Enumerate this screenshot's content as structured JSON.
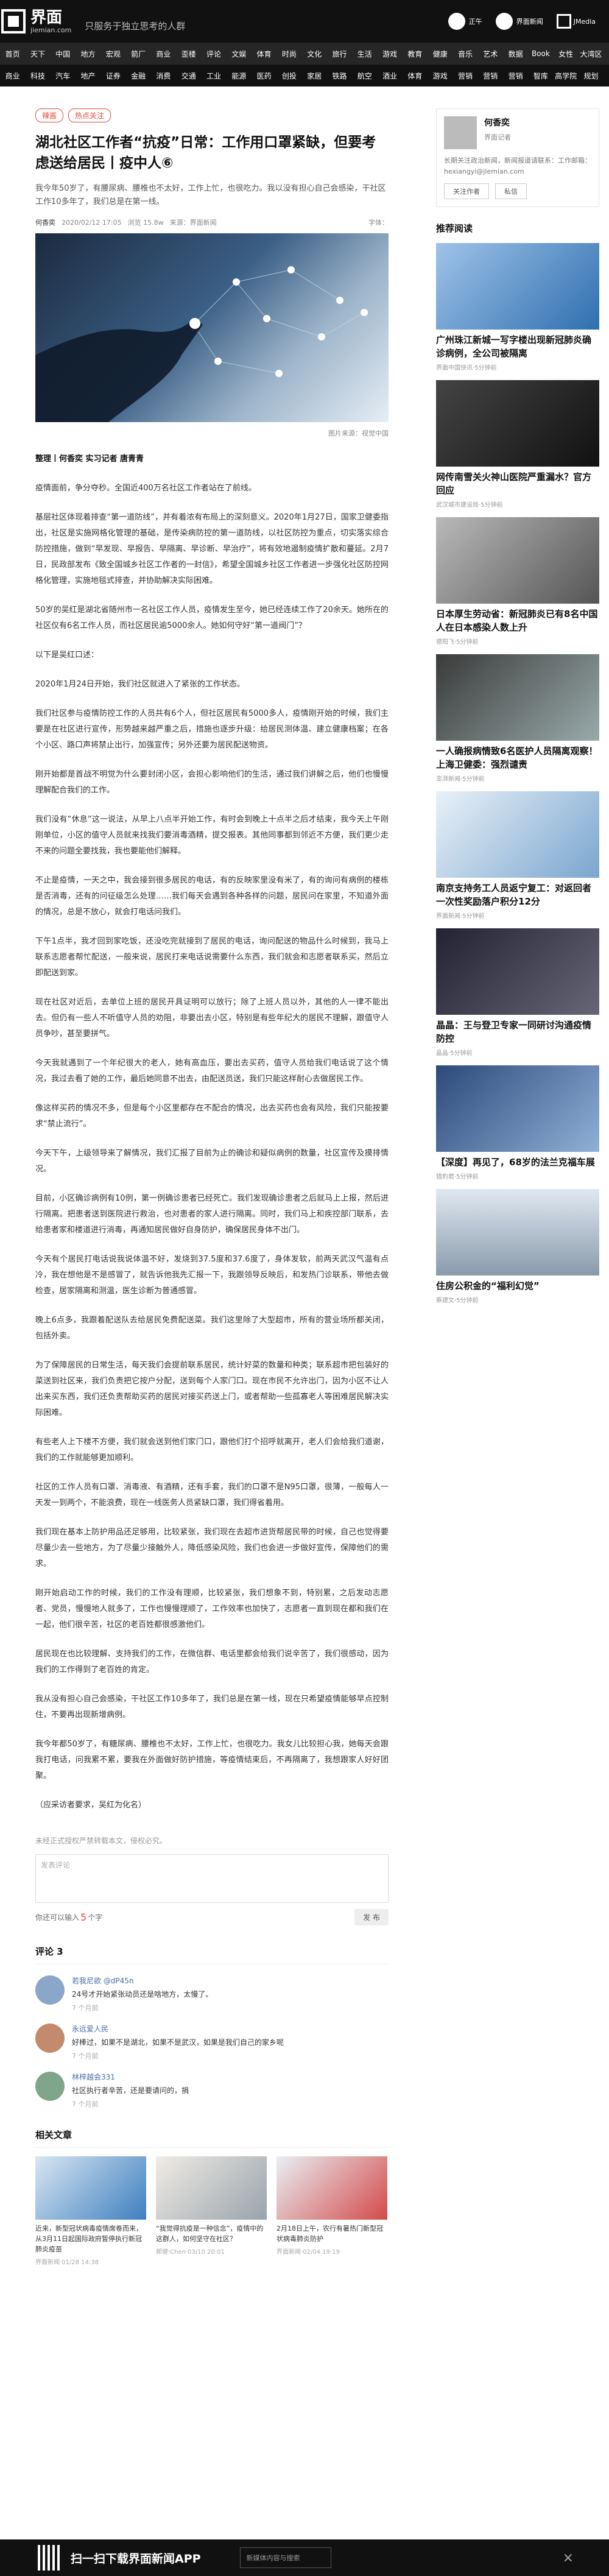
{
  "header": {
    "logo_cn": "界面",
    "logo_en": "jiemian.com",
    "slogan": "只服务于独立思考的人群",
    "right_items": [
      "正午",
      "界面新闻",
      "JMedia"
    ]
  },
  "nav_primary": [
    "首页",
    "天下",
    "中国",
    "地方",
    "宏观",
    "箭厂",
    "商业",
    "歪楼",
    "评论",
    "文娱",
    "体育",
    "时尚",
    "文化",
    "旅行",
    "生活",
    "游戏",
    "教育",
    "健康",
    "音乐",
    "艺术",
    "数据",
    "Book",
    "女性",
    "大湾区"
  ],
  "nav_secondary": [
    "商业",
    "科技",
    "汽车",
    "地产",
    "证券",
    "金融",
    "消费",
    "交通",
    "工业",
    "能源",
    "医药",
    "创投",
    "家居",
    "铁路",
    "航空",
    "酒业",
    "体育",
    "游戏",
    "营销",
    "营销",
    "营销",
    "智库",
    "高学院",
    "规划"
  ],
  "article": {
    "tags": [
      "辣酱",
      "热点关注"
    ],
    "title": "湖北社区工作者“抗疫”日常：工作用口罩紧缺，但要考虑送给居民丨疫中人⑥",
    "lead": "我今年50岁了，有腰尿病、腰椎也不太好，工作上忙，也很吃力。我以没有担心自己会感染，干社区工作10多年了，我们总是在第一线。",
    "author": "何香奕",
    "time": "2020/02/12 17:05",
    "views": "浏览 15.8w",
    "source": "来源：界面新闻",
    "font_size": "字体：   ",
    "caption": "图片来源：视觉中国",
    "byline": "整理丨何香奕 实习记者 唐青青",
    "paragraphs": [
      "疫情面前，争分夺秒。全国近400万名社区工作者站在了前线。",
      "基层社区体现着排查“第一道防线”，并有着浓有布局上的深刻意义。2020年1月27日，国家卫健委指出，社区是实施网格化管理的基础，是传染病防控的第一道防线，以社区防控为重点，切实落实综合防控措施，做到“早发现、早报告、早隔离、早诊断、早治疗”，将有效地遏制疫情扩散和蔓延。2月7日，民政部发布《致全国城乡社区工作者的一封信》，希望全国城乡社区工作者进一步强化社区防控网格化管理，实施地毯式排查，并协助解决实际困难。",
      "50岁的吴红是湖北省随州市一名社区工作人员，疫情发生至今，她已经连续工作了20余天。她所在的社区仅有6名工作人员，而社区居民逾5000余人。她如何守好“第一道阀门”？",
      "以下是吴红口述：",
      "2020年1月24日开始，我们社区就进入了紧张的工作状态。",
      "我们社区参与疫情防控工作的人员共有6个人，但社区居民有5000多人，疫情刚开始的时候，我们主要是在社区进行宣传，形势越来越严重之后，措施也逐步升级：给居民测体温、建立健康档案；在各个小区、路口声将禁止出行，加强宣传；另外还要为居民配送物资。",
      "刚开始都是首战不明觉为什么要封闭小区，会担心影响他们的生活，通过我们讲解之后，他们也慢慢理解配合我们的工作。",
      "我们没有“休息”这一说法，从早上八点半开始工作，有时会到晚上十点半之后才结束，我今天上午刚刚单位，小区的值守人员就来找我们要消毒酒精，提交报表。其他同事都到邻近不方便，我们更少走不来的问题全要找我，我也要能他们解释。",
      "不止是疫情，一天之中，我会接到很多居民的电话，有的反映家里没有米了，有的询问有病例的楼栋是否消毒，还有的问征级怎么处理……我们每天会遇到各种各样的问题，居民问在家里，不知道外面的情况，总是不放心，就会打电话问我们。",
      "下午1点半，我才回到家吃饭，还没吃完就接到了居民的电话，询问配送的物品什么时候到，我马上联系志愿者帮忙配送，一般来说，居民打来电话说需要什么东西，我们就会和志愿者联系买，然后立即配送到家。",
      "现在社区对近后，去单位上班的居民开具证明可以放行；除了上班人员以外，其他的人一律不能出去。但仍有一些人不听值守人员的劝阻，非要出去小区，特别是有些年纪大的居民不理解，跟值守人员争吵，甚至要拼气。",
      "今天我就遇到了一个年纪很大的老人，她有高血压，要出去买药，值守人员给我们电话说了这个情况，我过去看了她的工作，最后她同意不出去，由配送员送，我们只能这样耐心去做居民工作。",
      "像这样买药的情况不多，但是每个小区里都存在不配合的情况，出去买药也会有风险，我们只能按要求“禁止流行”。",
      "今天下午，上级领导来了解情况，我们汇报了目前为止的确诊和疑似病例的数量，社区宣传及摸排情况。",
      "目前，小区确诊病例有10例，第一例确诊患者已经死亡。我们发现确诊患者之后就马上上报，然后进行隔离。把患者送到医院进行救治，也对患者的家人进行隔离。同时，我们马上和疾控部门联系，去给患者家和楼道进行消毒，再通知居民做好自身防护，确保居民身体不出门。",
      "今天有个居民打电话说我说体温不好，发烧到37.5度和37.6度了，身体发软，前两天武汉气温有点冷，我在想他是不是感冒了，就告诉他我先汇报一下，我跟领导反映后，和发热门诊联系，带他去做检查，居家隔离和测温，医生诊断为普通感冒。",
      "晚上6点多，我跟着配送队去给居民免费配送菜。我们这里除了大型超市，所有的营业场所都关闭，包括外卖。",
      "为了保障居民的日常生活，每天我们会提前联系居民，统计好菜的数量和种类；联系超市把包装好的菜送到社区来，我们负责把它按户分配，送到每个人家门口。现在市民不允许出门，因为小区不让人出来买东西，我们还负责帮助买药的居民对接买药送上门，或者帮助一些孤寡老人等困难居民解决实际困难。",
      "有些老人上下楼不方便，我们就会送到他们家门口，跟他们打个招呼就离开，老人们会给我们道谢，我们的工作就能够更加顺利。",
      "社区的工作人员有口罩、消毒液、有酒精，还有手套，我们的口罩不是N95口罩，很薄，一般每人一天发一到两个，不能浪费，现在一线医务人员紧缺口罩，我们得省着用。",
      "我们现在基本上防护用品还足够用，比较紧张，我们现在去超市进货帮居民带的时候，自己也觉得要尽量少去一些地方，为了尽量少接触外人，降低感染风险，我们也会进一步做好宣传，保障他们的需求。",
      "刚开始启动工作的时候，我们的工作没有理顺，比较紧张，我们想象不到，特别累，之后发动志愿者、党员，慢慢地人就多了，工作也慢慢理顺了，工作效率也加快了，志愿者一直到现在都和我们在一起，他们很辛苦，社区的老百姓都很感激他们。",
      "居民现在也比较理解、支持我们的工作，在微信群、电话里都会给我们说辛苦了，我们很感动，因为我们的工作得到了老百姓的肯定。",
      "我从没有担心自己会感染，干社区工作10多年了，我们总是在第一线，现在只希望疫情能够早点控制住，不要再出现新增病例。",
      "我今年都50岁了，有糖尿病、腰椎也不太好，工作上忙，也很吃力。我女儿比较担心我，她每天会跟我打电话，问我累不累，要我在外面做好防护措施，等疫情结束后，不再隔离了，我想跟家人好好团聚。",
      "（应采访者要求，吴红为化名）"
    ],
    "copyright_note": "未经正式授权严禁转载本文，侵权必究。"
  },
  "comment": {
    "placeholder": "发表评论",
    "bottom_text": "你还可以输入",
    "remaining": "5",
    "unit": "个字",
    "submit": "发 布",
    "section_title": "评论 3",
    "items": [
      {
        "name": "若我尼欲 @dP45n",
        "text": "24号才开始紧张动员还是啥地方，太慢了。",
        "time": "7 个月前"
      },
      {
        "name": "永远爱人民",
        "text": "好棒过，如果不是湖北，如果不是武汉，如果是我们自己的家乡呢",
        "time": "7 个月前"
      },
      {
        "name": "林梓越会331",
        "text": "社区执行者辛苦，还是要请问的，捐",
        "time": "7 个月前"
      }
    ]
  },
  "related": {
    "title": "相关文章",
    "items": [
      {
        "title": "近来，新型冠状病毒疫情席卷而来，从3月11日起国际政府暂停执行新冠肺炎疫苗",
        "meta": "界面新闻·01/28 14:38"
      },
      {
        "title": "“我觉得抗疫是一种信念”，疫情中的这群人，如何坚守在社区？",
        "meta": "郝健·Chen·03/10 20:01"
      },
      {
        "title": "2月18日上午，农行有暑热门新型冠状病毒肺炎防护",
        "meta": "界面新闻·02/04 19:19"
      }
    ]
  },
  "sidebar": {
    "author_name": "何香奕",
    "author_role": "界面记者",
    "author_desc": "长期关注政治新闻，新闻报道请联系：工作邮箱：hexiangyi@jiemian.com",
    "follow": "关注作者",
    "message": "私信",
    "recommend_title": "推荐阅读",
    "items": [
      {
        "title": "广州珠江新城一写字楼出现新冠肺炎确诊病例，全公司被隔离",
        "meta": "界面中国快讯·5分钟前"
      },
      {
        "title": "网传南雪关火神山医院严重漏水？官方回应",
        "meta": "武汉城市建设局·5分钟前"
      },
      {
        "title": "日本厚生劳动省：新冠肺炎已有8名中国人在日本感染人数上升",
        "meta": "德阳飞·5分钟前"
      },
      {
        "title": "一人确报病情致6名医护人员隔离观察！上海卫健委：强烈谴责",
        "meta": "澎湃新闻·5分钟前"
      },
      {
        "title": "南京支持务工人员返宁复工：对返回者一次性奖励落户积分12分",
        "meta": "界面新闻·5分钟前"
      },
      {
        "title": "晶晶：王与登卫专家一同研讨沟通疫情防控",
        "meta": "晶晶·5分钟前"
      },
      {
        "title": "【深度】再见了，68岁的法兰克福车展",
        "meta": "猎豹君·5分钟前"
      },
      {
        "title": "住房公积金的“福利幻觉”",
        "meta": "蔡建文·5分钟前"
      }
    ]
  },
  "footer": {
    "text": "扫一扫下载界面新闻APP",
    "search_placeholder": "新媒体内容与搜索",
    "close": "×"
  }
}
